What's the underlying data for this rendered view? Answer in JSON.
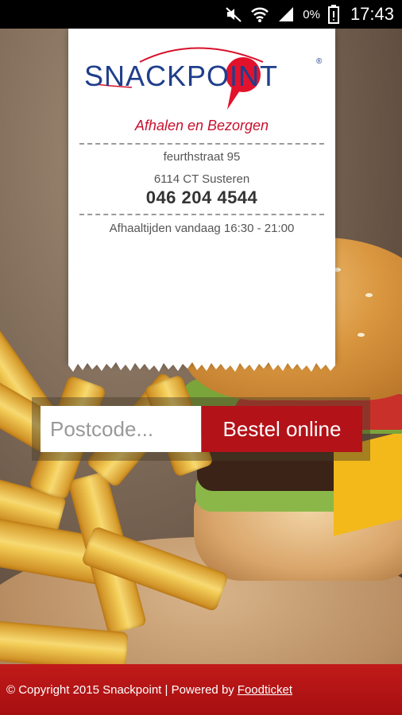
{
  "status_bar": {
    "time": "17:43",
    "battery_percent": "0%",
    "icons": [
      "mute-icon",
      "wifi-icon",
      "signal-icon",
      "battery-icon"
    ]
  },
  "receipt": {
    "logo_text": "SNACKPOINT",
    "tagline": "Afhalen en Bezorgen",
    "address_line1": "feurthstraat 95",
    "address_line2": "6114 CT Susteren",
    "phone": "046 204 4544",
    "hours": "Afhaaltijden vandaag 16:30 - 21:00"
  },
  "order": {
    "postcode_placeholder": "Postcode...",
    "button_label": "Bestel online"
  },
  "footer": {
    "copyright": "© Copyright 2015 Snackpoint | Powered by",
    "link": "Foodticket"
  },
  "colors": {
    "accent_red": "#b31218",
    "brand_blue": "#1f3e8c",
    "footer_red": "#c11a1a"
  }
}
